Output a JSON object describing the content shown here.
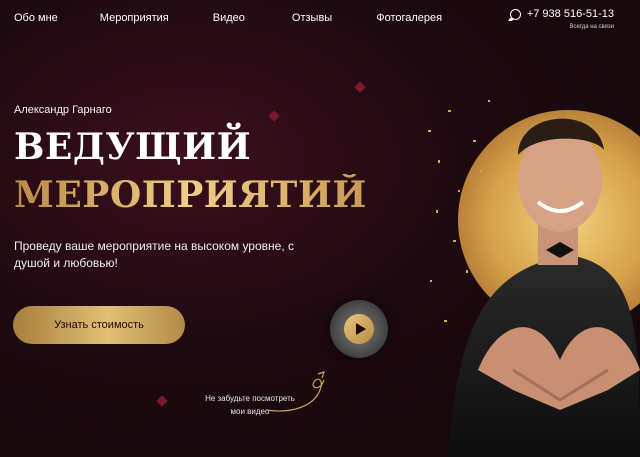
{
  "nav": {
    "items": [
      "Обо мне",
      "Мероприятия",
      "Видео",
      "Отзывы",
      "Фотогалерея"
    ]
  },
  "contact": {
    "phone": "+7 938 516-51-13",
    "availability": "Всегда на связи"
  },
  "hero": {
    "name": "Александр Гарнаго",
    "title_line1": "ВЕДУЩИЙ",
    "title_line2": "МЕРОПРИЯТИЙ",
    "description": "Проведу ваше мероприятие на высоком уровне, с душой и любовью!",
    "cta_label": "Узнать стоимость",
    "video_hint_line1": "Не забудьте посмотреть",
    "video_hint_line2": "мои видео"
  },
  "colors": {
    "accent_gold": "#e3bf74",
    "background": "#1e0a10"
  },
  "icons": {
    "whatsapp": "whatsapp-icon",
    "play": "play-icon"
  }
}
